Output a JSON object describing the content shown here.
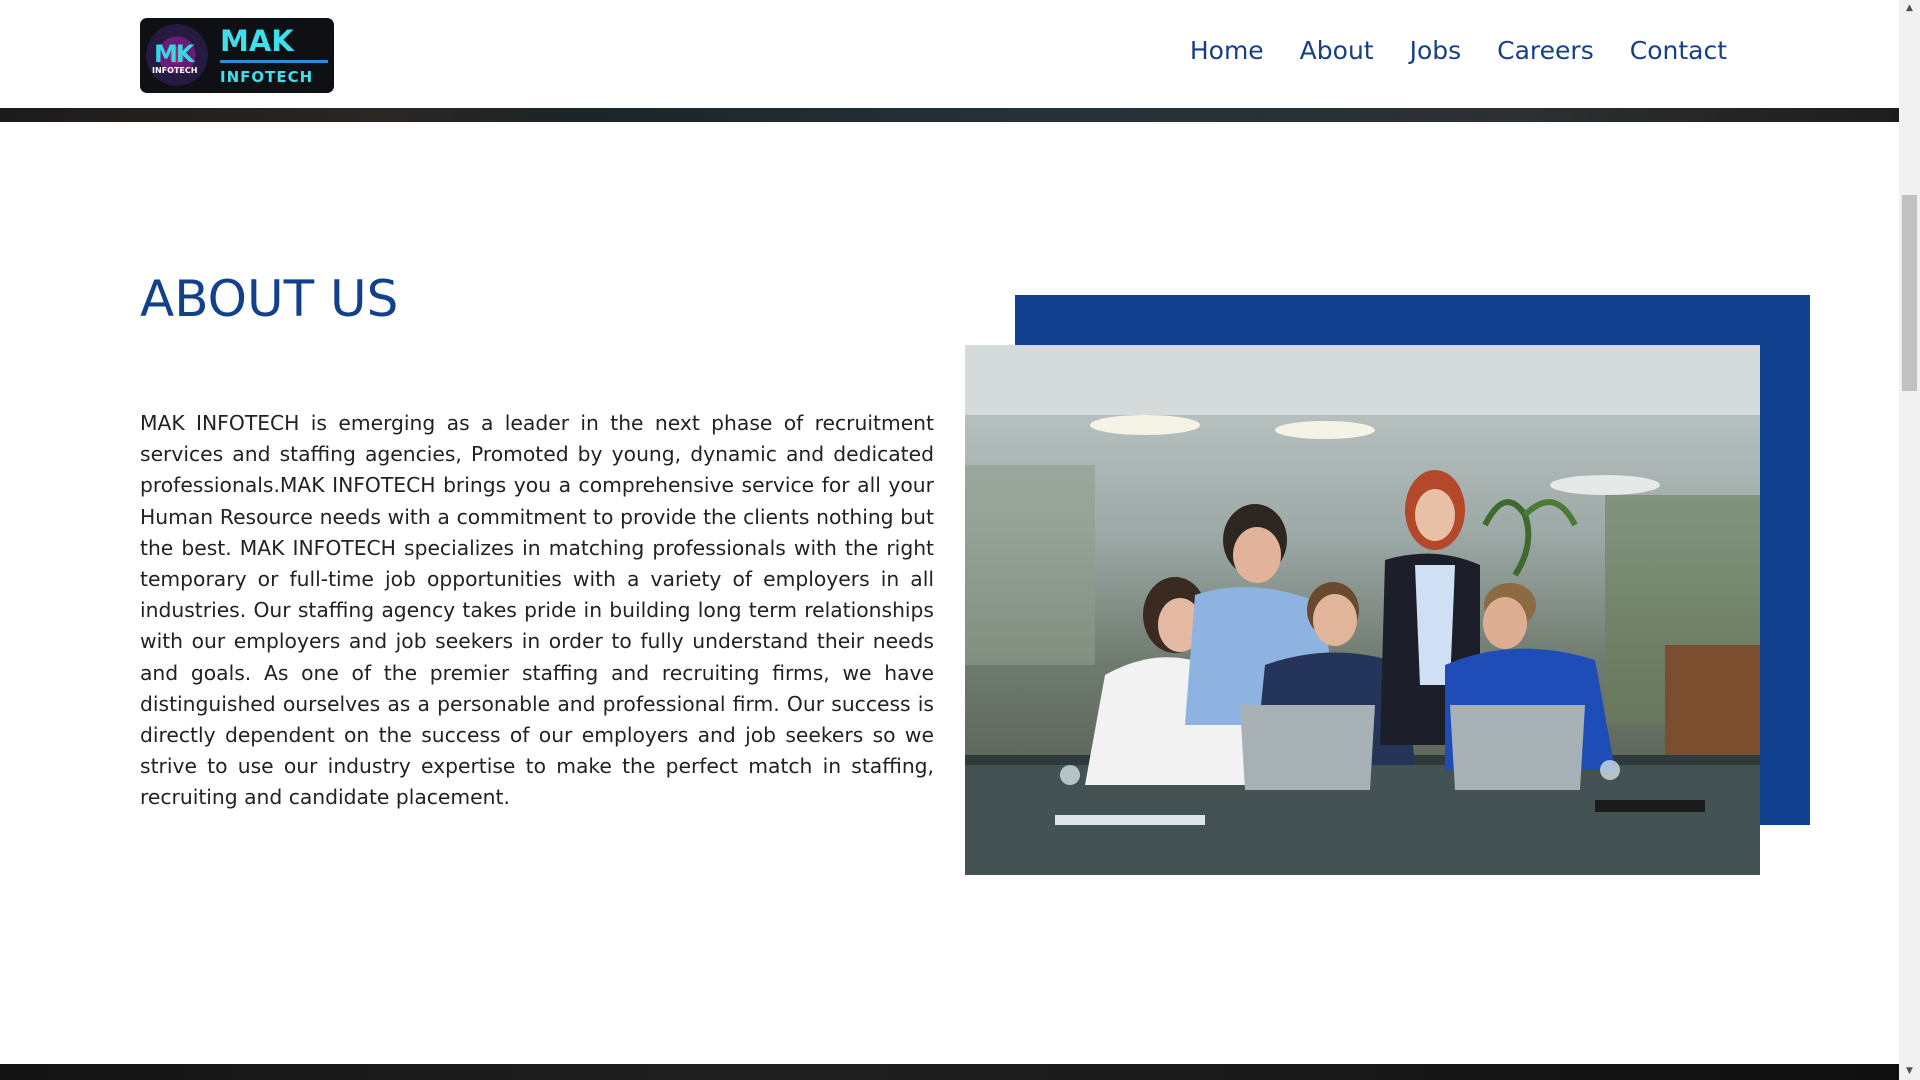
{
  "header": {
    "logo": {
      "word1": "MAK",
      "word2": "INFOTECH",
      "mark": "MK",
      "mini": "INFOTECH"
    },
    "nav": [
      "Home",
      "About",
      "Jobs",
      "Careers",
      "Contact"
    ]
  },
  "about": {
    "title": "ABOUT US",
    "body": "MAK INFOTECH is emerging as a leader in the next phase of recruitment services and staffing agencies, Promoted by young, dynamic and dedicated professionals.MAK INFOTECH brings you a comprehensive service for all your Human Resource needs with a commitment to provide the clients nothing but the best. MAK INFOTECH specializes in matching professionals with the right temporary or full-time job opportunities with a variety of employers in all industries. Our staffing agency takes pride in building long term relationships with our employers and job seekers in order to fully understand their needs and goals. As one of the premier staffing and recruiting firms, we have distinguished ourselves as a personable and professional firm. Our success is directly dependent on the success of our employers and job seekers so we strive to use our industry expertise to make the perfect match in staffing, recruiting and candidate placement."
  },
  "colors": {
    "brand_blue": "#11418e",
    "nav_text": "#173f86",
    "logo_cyan": "#3ee0ec"
  },
  "scrollbar": {
    "up_icon": "triangle-up",
    "down_icon": "triangle-down"
  }
}
